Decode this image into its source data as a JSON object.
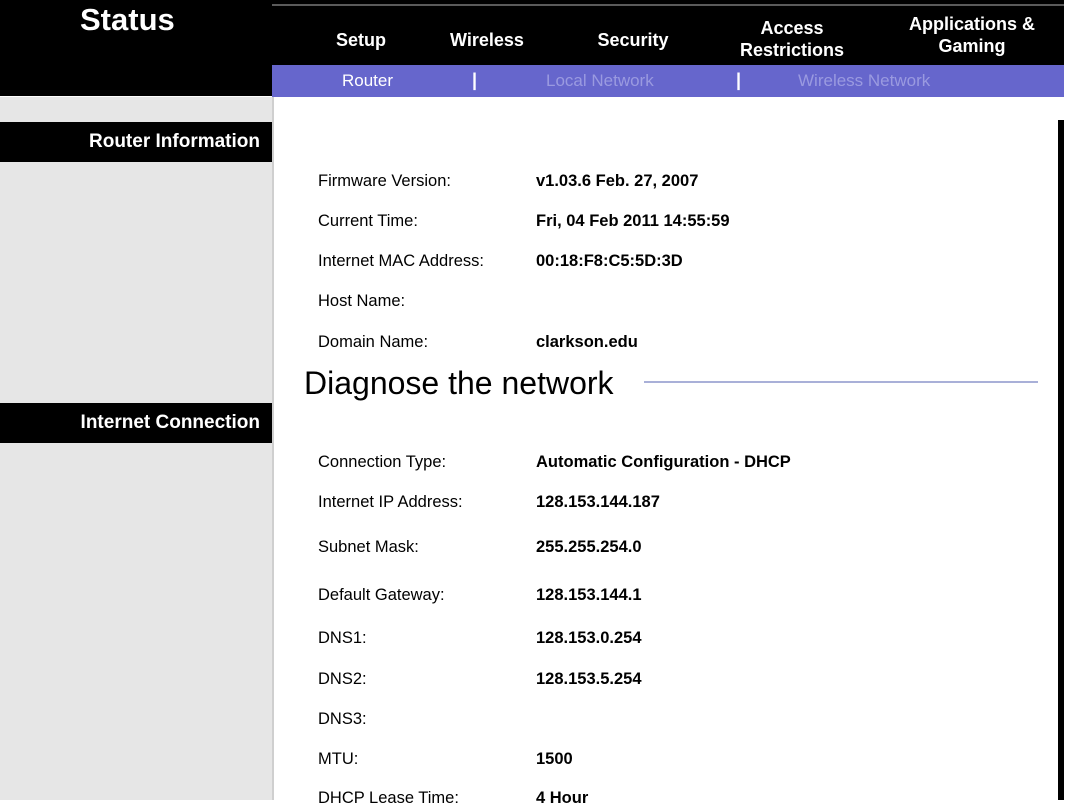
{
  "page_title": "Status",
  "nav": {
    "items": [
      {
        "label_lines": [
          "Setup"
        ]
      },
      {
        "label_lines": [
          "Wireless"
        ]
      },
      {
        "label_lines": [
          "Security"
        ]
      },
      {
        "label_lines": [
          "Access",
          "Restrictions"
        ]
      },
      {
        "label_lines": [
          "Applications &",
          "Gaming"
        ]
      }
    ]
  },
  "subnav": {
    "items": [
      {
        "label": "Router",
        "active": true
      },
      {
        "label": "Local Network",
        "active": false
      },
      {
        "label": "Wireless Network",
        "active": false
      }
    ],
    "separator": "|"
  },
  "sections": {
    "router_information": {
      "heading": "Router Information",
      "rows": [
        {
          "label": "Firmware Version:",
          "value": "v1.03.6 Feb. 27, 2007"
        },
        {
          "label": "Current Time:",
          "value": "Fri, 04 Feb 2011 14:55:59"
        },
        {
          "label": "Internet MAC Address:",
          "value": "00:18:F8:C5:5D:3D"
        },
        {
          "label": "Host Name:",
          "value": ""
        },
        {
          "label": "Domain Name:",
          "value": "clarkson.edu"
        }
      ]
    },
    "internet_connection": {
      "heading": "Internet Connection",
      "rows": [
        {
          "label": "Connection Type:",
          "value": "Automatic Configuration - DHCP"
        },
        {
          "label": "Internet IP Address:",
          "value": "128.153.144.187"
        },
        {
          "label": "Subnet Mask:",
          "value": "255.255.254.0"
        },
        {
          "label": "Default Gateway:",
          "value": "128.153.144.1"
        },
        {
          "label": "DNS1:",
          "value": "128.153.0.254"
        },
        {
          "label": "DNS2:",
          "value": "128.153.5.254"
        },
        {
          "label": "DNS3:",
          "value": ""
        },
        {
          "label": "MTU:",
          "value": "1500"
        },
        {
          "label": "DHCP Lease Time:",
          "value": "4 Hour"
        }
      ]
    }
  },
  "overlay": {
    "caption": "Diagnose the network"
  }
}
